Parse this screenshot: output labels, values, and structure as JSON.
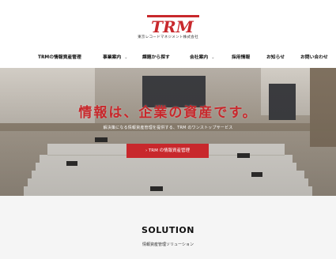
{
  "header": {
    "logo_text": "TRM",
    "company_name": "東京レコードマネジメント株式会社"
  },
  "nav": {
    "items": [
      {
        "label": "TRMの情報資産管理",
        "has_dropdown": false
      },
      {
        "label": "事業案内",
        "has_dropdown": true
      },
      {
        "label": "課題から探す",
        "has_dropdown": false
      },
      {
        "label": "会社案内",
        "has_dropdown": true
      },
      {
        "label": "採用情報",
        "has_dropdown": false
      },
      {
        "label": "お知らせ",
        "has_dropdown": false
      },
      {
        "label": "お問い合わせ",
        "has_dropdown": false
      }
    ],
    "caret": "⌄"
  },
  "hero": {
    "title": "情報は、企業の資産です。",
    "subtitle": "解決策になる情報資産管理を提供する、TRM のワンストップサービス",
    "button_label": "› TRM の情報資産管理"
  },
  "solution": {
    "title": "SOLUTION",
    "subtitle": "情報資産管理ソリューション"
  },
  "colors": {
    "accent": "#c8282c",
    "background": "#ffffff",
    "section_bg": "#f5f5f5"
  }
}
